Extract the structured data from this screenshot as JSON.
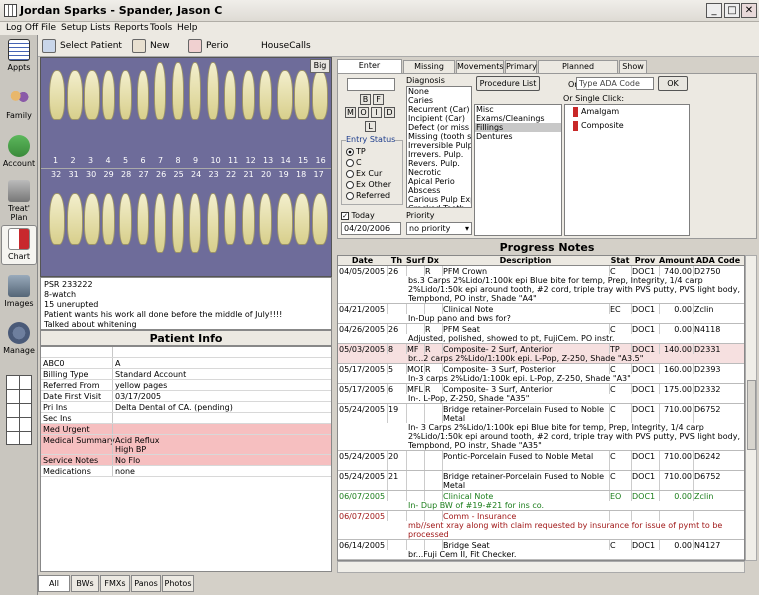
{
  "window": {
    "title": "Jordan Sparks - Spander, Jason C"
  },
  "menu": [
    "Log Off",
    "File",
    "Setup",
    "Lists",
    "Reports",
    "Tools",
    "Help"
  ],
  "toolbar": {
    "select_patient": "Select Patient",
    "new_rx": "New Rx",
    "perio_chart": "Perio Chart",
    "housecalls": "HouseCalls"
  },
  "modules": [
    "Appts",
    "Family",
    "Account",
    "Treat' Plan",
    "Chart",
    "Images",
    "Manage"
  ],
  "chart": {
    "big": "Big",
    "upper_numbers": [
      "1",
      "2",
      "3",
      "4",
      "5",
      "6",
      "7",
      "8",
      "9",
      "10",
      "11",
      "12",
      "13",
      "14",
      "15",
      "16"
    ],
    "lower_numbers": [
      "32",
      "31",
      "30",
      "29",
      "28",
      "27",
      "26",
      "25",
      "24",
      "23",
      "22",
      "21",
      "20",
      "19",
      "18",
      "17"
    ]
  },
  "notes": [
    "PSR  233222",
    "8-watch",
    "15 unerupted",
    "Patient wants his work all done before the middle of July!!!!",
    "Talked about whitening"
  ],
  "patient_info": {
    "title": "Patient Info",
    "rows": [
      {
        "k": "",
        "v": "",
        "pink": false
      },
      {
        "k": "ABC0",
        "v": "A",
        "pink": false
      },
      {
        "k": "Billing Type",
        "v": "Standard Account",
        "pink": false
      },
      {
        "k": "Referred From",
        "v": "yellow pages",
        "pink": false
      },
      {
        "k": "Date First Visit",
        "v": "03/17/2005",
        "pink": false
      },
      {
        "k": "Pri Ins",
        "v": "Delta Dental of CA. (pending)",
        "pink": false
      },
      {
        "k": "Sec Ins",
        "v": "",
        "pink": false
      },
      {
        "k": "Med Urgent",
        "v": "",
        "pink": true
      },
      {
        "k": "Medical Summary",
        "v": "Acid Reflux",
        "v2": "High BP",
        "pink": true
      },
      {
        "k": "Service Notes",
        "v": "No Flo",
        "pink": true
      },
      {
        "k": "Medications",
        "v": "none",
        "pink": false
      }
    ]
  },
  "image_tabs": [
    "All",
    "BWs",
    "FMXs",
    "Panos",
    "Photos"
  ],
  "tabs": [
    "Enter Treatment",
    "Missing Teeth",
    "Movements",
    "Primary",
    "Planned Appointment",
    "Show"
  ],
  "treatment": {
    "surfaces": [
      "B",
      "F",
      "M",
      "O",
      "I",
      "D",
      "L"
    ],
    "entry_status_label": "Entry Status",
    "statuses": [
      "TP",
      "C",
      "Ex Cur",
      "Ex Other",
      "Referred"
    ],
    "today_label": "Today",
    "date": "04/20/2006",
    "priority_label": "Priority",
    "priority": "no priority",
    "diagnosis_label": "Diagnosis",
    "diagnoses": [
      "None",
      "Caries",
      "Recurrent (Car)",
      "Incipient (Car)",
      "Defect (or miss fill)",
      "Missing (tooth stru",
      "Irreversible Pulp.",
      "Irrevers. Pulp.",
      "Revers. Pulp.",
      "Necrotic",
      "Apical Perio",
      "Abscess",
      "Carious Pulp Exp",
      "Cracked Tooth"
    ],
    "procedure_list": "Procedure List",
    "or": "Or",
    "ada_placeholder": "Type ADA Code",
    "ok": "OK",
    "single_click": "Or Single Click:",
    "categories": [
      "Misc",
      "Exams/Cleanings",
      "Fillings",
      "Dentures"
    ],
    "quick": [
      "Amalgam",
      "Composite"
    ]
  },
  "progress": {
    "title": "Progress Notes",
    "cols": [
      "Date",
      "Th",
      "Surf",
      "Dx",
      "Description",
      "Stat",
      "Prov",
      "Amount",
      "ADA Code"
    ],
    "rows": [
      {
        "d": "04/05/2005",
        "th": "26",
        "s": "",
        "dx": "R",
        "desc": "PFM Crown",
        "st": "C",
        "p": "DOC1",
        "a": "740.00",
        "c": "D2750",
        "note": "bs.3 Carps 2%Lido/1:100k epi  Blue bite for temp, Prep, Integrity, 1/4 carp 2%Lido/1:50k epi around tooth, #2 cord,  triple tray with PVS putty, PVS light body, Tempbond, PO instr, Shade \"A4\"",
        "h": 4,
        "col": "#000"
      },
      {
        "d": "04/21/2005",
        "th": "",
        "s": "",
        "dx": "",
        "desc": "Clinical Note",
        "st": "EC",
        "p": "DOC1",
        "a": "0.00",
        "c": "Zclin",
        "note": "In-Dup pano and bws for?",
        "h": 2,
        "col": "#000"
      },
      {
        "d": "04/26/2005",
        "th": "26",
        "s": "",
        "dx": "R",
        "desc": "PFM Seat",
        "st": "C",
        "p": "DOC1",
        "a": "0.00",
        "c": "N4118",
        "note": "Adjusted, polished, showed to pt, FujiCem.  PO instr.",
        "h": 2,
        "col": "#000"
      },
      {
        "d": "05/03/2005",
        "th": "8",
        "s": "MF",
        "dx": "R",
        "desc": "Composite- 2 Surf, Anterior",
        "st": "TP",
        "p": "DOC1",
        "a": "140.00",
        "c": "D2331",
        "note": "br...2 carps 2%Lido/1:100k epi. L-Pop, Z-250, Shade \"A3.5\"",
        "h": 2,
        "col": "#000",
        "pink": true
      },
      {
        "d": "05/17/2005",
        "th": "5",
        "s": "MOD",
        "dx": "R",
        "desc": "Composite- 3 Surf, Posterior",
        "st": "C",
        "p": "DOC1",
        "a": "160.00",
        "c": "D2393",
        "note": "In-3 carps 2%Lido/1:100k epi. L-Pop, Z-250, Shade \"A3\"",
        "h": 2,
        "col": "#000"
      },
      {
        "d": "05/17/2005",
        "th": "6",
        "s": "MFL",
        "dx": "R",
        "desc": "Composite- 3 Surf, Anterior",
        "st": "C",
        "p": "DOC1",
        "a": "175.00",
        "c": "D2332",
        "note": "In-. L-Pop, Z-250, Shade \"A35\"",
        "h": 2,
        "col": "#000"
      },
      {
        "d": "05/24/2005",
        "th": "19",
        "s": "",
        "dx": "",
        "desc": "Bridge retainer-Porcelain Fused to Noble Metal",
        "st": "C",
        "p": "DOC1",
        "a": "710.00",
        "c": "D6752",
        "note": "In- 3 Carps 2%Lido/1:100k epi  Blue bite for temp, Prep, Integrity, 1/4 carp 2%Lido/1:50k epi around tooth, #2 cord,  triple tray with PVS putty, PVS light body, Tempbond, PO instr, Shade \"A35\"",
        "h": 6,
        "col": "#000"
      },
      {
        "d": "05/24/2005",
        "th": "20",
        "s": "",
        "dx": "",
        "desc": "Pontic-Porcelain Fused to Noble Metal",
        "st": "C",
        "p": "DOC1",
        "a": "710.00",
        "c": "D6242",
        "note": "",
        "h": 1,
        "col": "#000"
      },
      {
        "d": "05/24/2005",
        "th": "21",
        "s": "",
        "dx": "",
        "desc": "Bridge retainer-Porcelain Fused to Noble Metal",
        "st": "C",
        "p": "DOC1",
        "a": "710.00",
        "c": "D6752",
        "note": "",
        "h": 2,
        "col": "#000"
      },
      {
        "d": "06/07/2005",
        "th": "",
        "s": "",
        "dx": "",
        "desc": "Clinical Note",
        "st": "EO",
        "p": "DOC1",
        "a": "0.00",
        "c": "Zclin",
        "note": "In- Dup BW of #19-#21 for ins co.",
        "h": 2,
        "col": "#1b7d1b"
      },
      {
        "d": "06/07/2005",
        "th": "",
        "s": "",
        "dx": "",
        "desc": "Comm - Insurance",
        "st": "",
        "p": "",
        "a": "",
        "c": "",
        "note": "mb//sent xray along with claim requested by insurance for issue of pymt to be processed",
        "h": 3,
        "col": "#a01818"
      },
      {
        "d": "06/14/2005",
        "th": "",
        "s": "",
        "dx": "",
        "desc": "Bridge Seat",
        "st": "C",
        "p": "DOC1",
        "a": "0.00",
        "c": "N4127",
        "note": "br...Fuji Cem II, Fit Checker.",
        "h": 2,
        "col": "#000"
      }
    ]
  }
}
